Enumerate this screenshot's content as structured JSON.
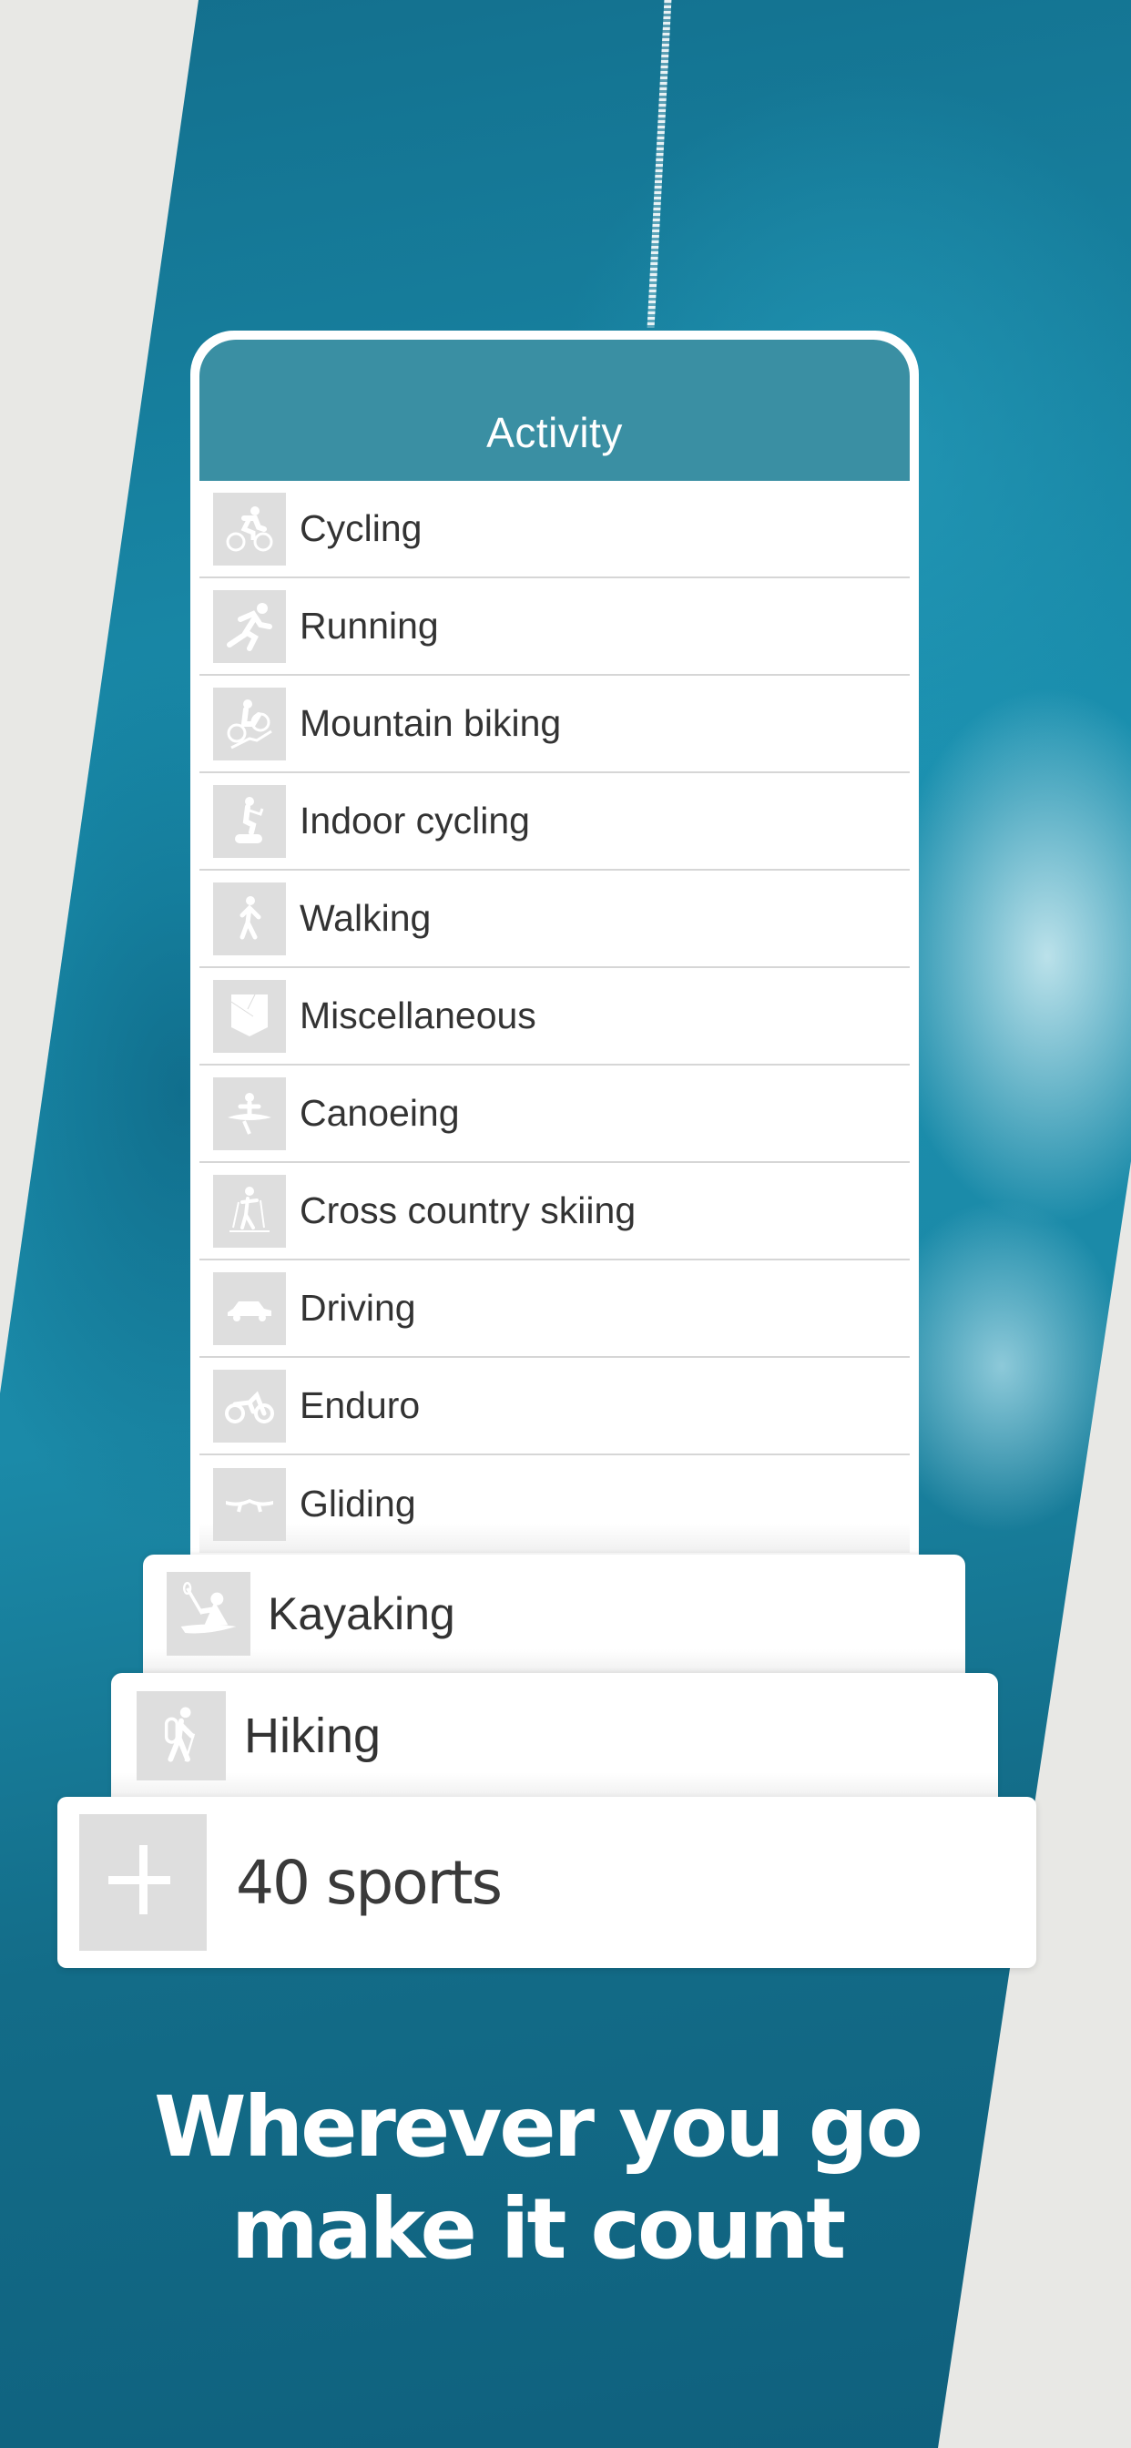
{
  "header": {
    "title": "Activity"
  },
  "activities": [
    {
      "label": "Cycling",
      "icon": "cycling-icon"
    },
    {
      "label": "Running",
      "icon": "running-icon"
    },
    {
      "label": "Mountain biking",
      "icon": "mountain-biking-icon"
    },
    {
      "label": "Indoor cycling",
      "icon": "indoor-cycling-icon"
    },
    {
      "label": "Walking",
      "icon": "walking-icon"
    },
    {
      "label": "Miscellaneous",
      "icon": "miscellaneous-icon"
    },
    {
      "label": "Canoeing",
      "icon": "canoeing-icon"
    },
    {
      "label": "Cross country skiing",
      "icon": "cross-country-skiing-icon"
    },
    {
      "label": "Driving",
      "icon": "driving-icon"
    },
    {
      "label": "Enduro",
      "icon": "enduro-icon"
    },
    {
      "label": "Gliding",
      "icon": "gliding-icon"
    }
  ],
  "stacked": [
    {
      "label": "Kayaking",
      "icon": "kayaking-icon"
    },
    {
      "label": "Hiking",
      "icon": "hiking-icon"
    }
  ],
  "more": {
    "label": "40 sports",
    "icon": "plus-icon"
  },
  "tagline": {
    "line1": "Wherever you go",
    "line2": "make it count"
  },
  "colors": {
    "header": "#3a8fa3",
    "brand_bg": "#1a8fae",
    "icon_tile": "#dedede"
  }
}
